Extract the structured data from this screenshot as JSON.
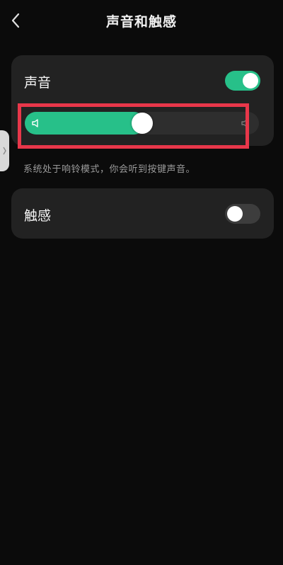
{
  "header": {
    "title": "声音和触感",
    "back_icon": "chevron-left-icon"
  },
  "sound": {
    "label": "声音",
    "toggle_on": true,
    "volume_level": 0.5,
    "min_icon": "speaker-low-icon",
    "max_icon": "speaker-high-icon"
  },
  "hint": "系统处于响铃模式，你会听到按键声音。",
  "haptic": {
    "label": "触感",
    "toggle_on": false
  },
  "colors": {
    "accent": "#27c089",
    "highlight": "#e8374a",
    "card": "#222222",
    "background": "#0b0b0b"
  }
}
